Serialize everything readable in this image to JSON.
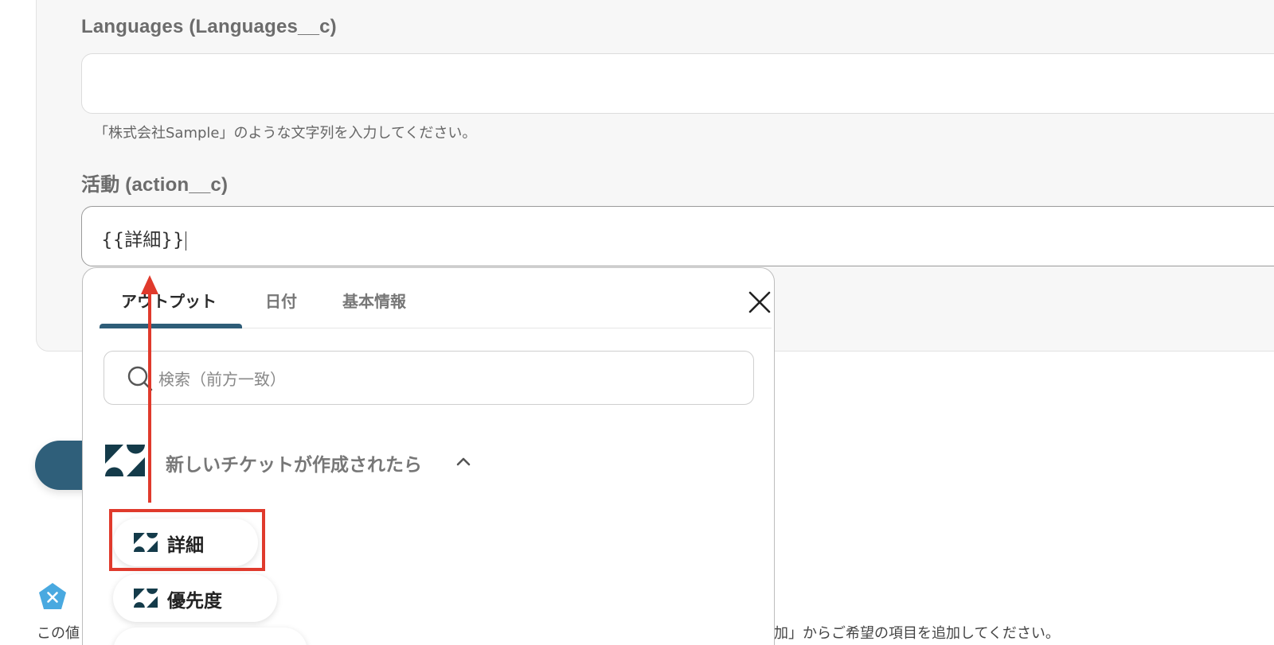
{
  "form": {
    "languages_label": "Languages (Languages__c)",
    "languages_value": "",
    "languages_helper": "「株式会社Sample」のような文字列を入力してください。",
    "action_label": "活動 (action__c)",
    "action_value": "{{詳細}}"
  },
  "dropdown": {
    "tabs": [
      {
        "label": "アウトプット",
        "active": true
      },
      {
        "label": "日付",
        "active": false
      },
      {
        "label": "基本情報",
        "active": false
      }
    ],
    "search_placeholder": "検索（前方一致）",
    "section_title": "新しいチケットが作成されたら",
    "items": [
      {
        "label": "詳細",
        "icon": "zendesk-logo-icon"
      },
      {
        "label": "優先度",
        "icon": "zendesk-logo-icon"
      }
    ]
  },
  "bottom": {
    "text_left": "この値",
    "text_right": "加」からご希望の項目を追加してください。"
  },
  "colors": {
    "accent": "#2e5d78",
    "annotation_red": "#e03a2c",
    "badge_blue": "#49a9e0"
  }
}
